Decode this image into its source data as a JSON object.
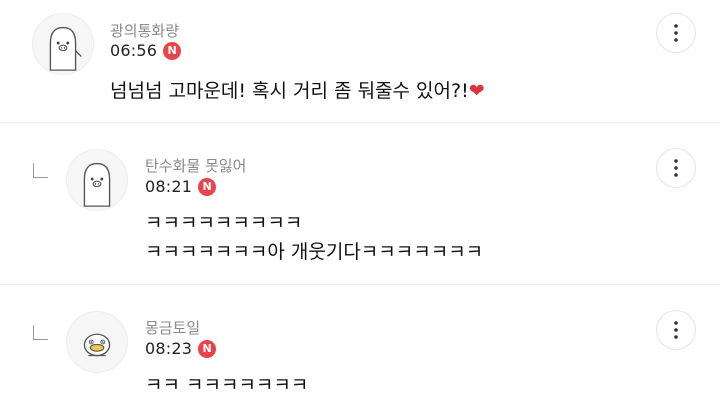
{
  "comments": [
    {
      "username": "광의통화량",
      "time": "06:56",
      "new_badge": "N",
      "lines": [
        "넘넘넘 고마운데! 혹시 거리 좀 둬줄수 있어?!"
      ],
      "heart": "❤",
      "avatar_icon": "ghost-pig-avatar-icon",
      "is_reply": false
    },
    {
      "username": "탄수화물 못잃어",
      "time": "08:21",
      "new_badge": "N",
      "lines": [
        "ㅋㅋㅋㅋㅋㅋㅋㅋㅋ",
        "ㅋㅋㅋㅋㅋㅋㅋ아 개웃기다ㅋㅋㅋㅋㅋㅋㅋ"
      ],
      "avatar_icon": "ghost-pig-avatar-icon",
      "is_reply": true
    },
    {
      "username": "몽금토일",
      "time": "08:23",
      "new_badge": "N",
      "lines": [
        "ㅋㅋ ㅋㅋㅋㅋㅋㅋㅋ"
      ],
      "avatar_icon": "duck-avatar-icon",
      "is_reply": true
    }
  ],
  "colors": {
    "badge": "#e8444b",
    "heart": "#e0323d",
    "username": "#8a8a8a",
    "divider": "#ececec"
  }
}
